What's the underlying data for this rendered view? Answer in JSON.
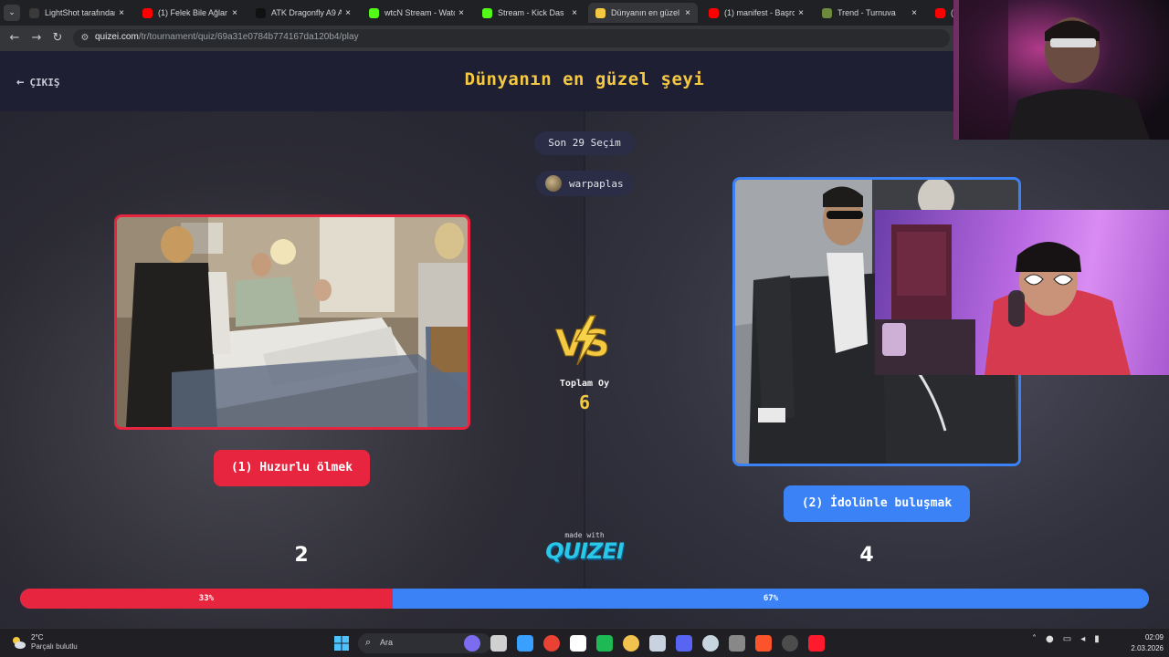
{
  "browser": {
    "tabs": [
      {
        "title": "LightShot tarafından",
        "favicon_color": "#3a3a3a"
      },
      {
        "title": "(1) Felek Bile Ağlar O",
        "favicon_color": "#ff0000"
      },
      {
        "title": "ATK Dragonfly A9 Air",
        "favicon_color": "#111111"
      },
      {
        "title": "wtcN Stream - Watch",
        "favicon_color": "#53fc18"
      },
      {
        "title": "Stream - Kick Das",
        "favicon_color": "#53fc18"
      },
      {
        "title": "Dünyanın en güzel ş",
        "favicon_color": "#f5c842"
      },
      {
        "title": "(1) manifest - Başrol",
        "favicon_color": "#ff0000"
      },
      {
        "title": "Trend - Turnuva",
        "favicon_color": "#6e8b3d"
      },
      {
        "title": "(1)",
        "favicon_color": "#ff0000"
      }
    ],
    "active_tab_index": 5,
    "url_host": "quizei.com",
    "url_path": "/tr/tournament/quiz/69a31e0784b774167da120b4/play"
  },
  "page": {
    "exit_label": "ÇIKIŞ",
    "title": "Dünyanın en güzel şeyi",
    "round_label": "Son 29 Seçim",
    "username": "warpaplas",
    "total_votes_label": "Toplam Oy",
    "total_votes": "6",
    "made_with": "made with",
    "brand": "QUIZEI"
  },
  "choices": [
    {
      "label": "(1) Huzurlu ölmek",
      "votes": 2,
      "percent": 33,
      "percent_label": "33%",
      "color": "#e8253f"
    },
    {
      "label": "(2) İdolünle buluşmak",
      "votes": 4,
      "percent": 67,
      "percent_label": "67%",
      "color": "#3b82f6"
    }
  ],
  "taskbar": {
    "weather_temp": "2°C",
    "weather_desc": "Parçalı bulutlu",
    "search_placeholder": "Ara",
    "time": "02:09",
    "date": "2.03.2026"
  }
}
